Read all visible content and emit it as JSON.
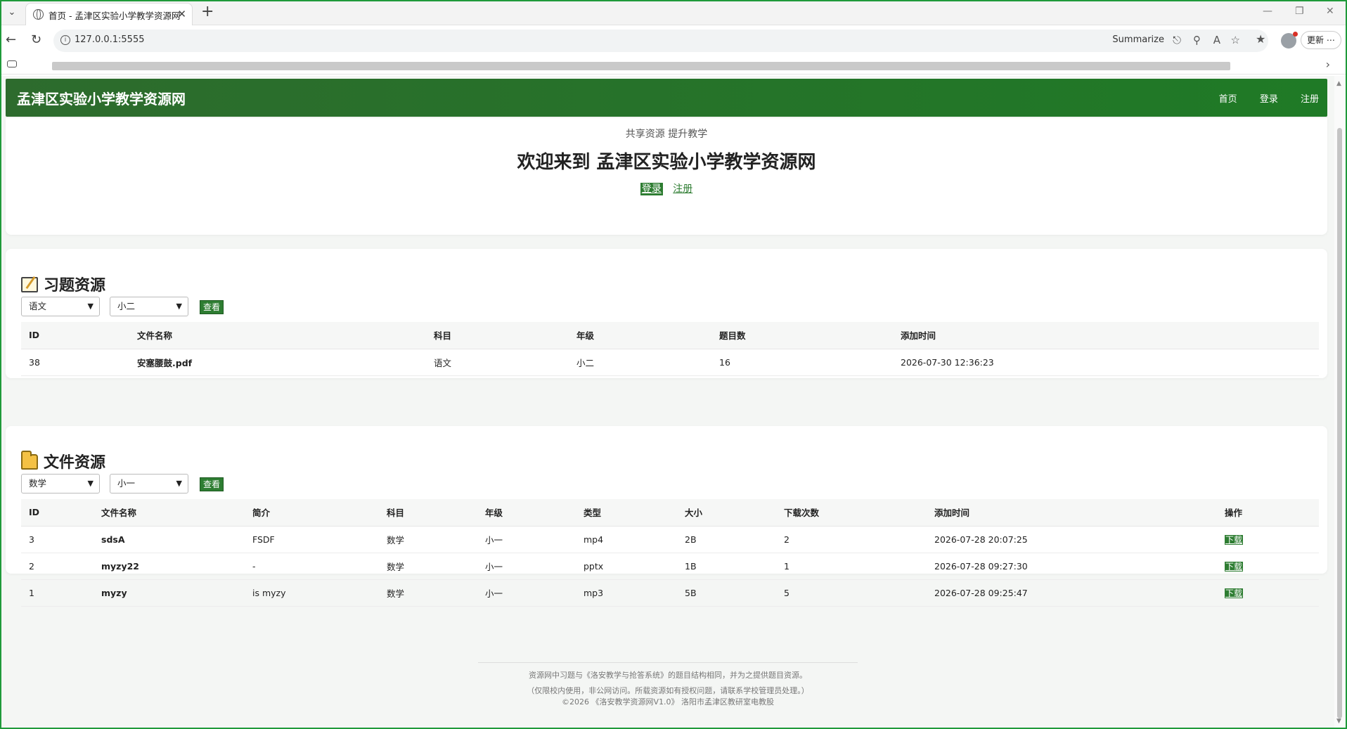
{
  "browser": {
    "tab_title": "首页 - 孟津区实验小学教学资源网",
    "url": "127.0.0.1:5555",
    "summarize_label": "Summarize",
    "update_label": "更新"
  },
  "site": {
    "title": "孟津区实验小学教学资源网",
    "nav": [
      "首页",
      "登录",
      "注册"
    ]
  },
  "hero": {
    "tagline": "共享资源 提升教学",
    "headline": "欢迎来到 孟津区实验小学教学资源网",
    "login_label": "登录",
    "register_label": "注册"
  },
  "exercises": {
    "title": "习题资源",
    "subject_selected": "语文",
    "grade_selected": "小二",
    "view_label": "查看",
    "columns": [
      "ID",
      "文件名称",
      "科目",
      "年级",
      "题目数",
      "添加时间"
    ],
    "rows": [
      [
        "38",
        "安塞腰鼓.pdf",
        "语文",
        "小二",
        "16",
        "2026-07-30 12:36:23"
      ]
    ]
  },
  "files": {
    "title": "文件资源",
    "subject_selected": "数学",
    "grade_selected": "小一",
    "view_label": "查看",
    "columns": [
      "ID",
      "文件名称",
      "简介",
      "科目",
      "年级",
      "类型",
      "大小",
      "下载次数",
      "添加时间",
      "操作"
    ],
    "rows": [
      [
        "3",
        "sdsA",
        "FSDF",
        "数学",
        "小一",
        "mp4",
        "2B",
        "2",
        "2026-07-28 20:07:25",
        "下载"
      ],
      [
        "2",
        "myzy22",
        "-",
        "数学",
        "小一",
        "pptx",
        "1B",
        "1",
        "2026-07-28 09:27:30",
        "下载"
      ],
      [
        "1",
        "myzy",
        "is myzy",
        "数学",
        "小一",
        "mp3",
        "5B",
        "5",
        "2026-07-28 09:25:47",
        "下载"
      ]
    ]
  },
  "footer": {
    "line1": "资源网中习题与《洛安教学与抢答系统》的题目结构相同，并为之提供题目资源。",
    "line2": "（仅限校内使用，非公网访问。所载资源如有授权问题，请联系学校管理员处理。）",
    "line3": "©2026 《洛安教学资源网V1.0》 洛阳市孟津区教研室电教股"
  },
  "colors": {
    "brand_green": "#2e7d32",
    "header_green": "#1f7a26"
  }
}
